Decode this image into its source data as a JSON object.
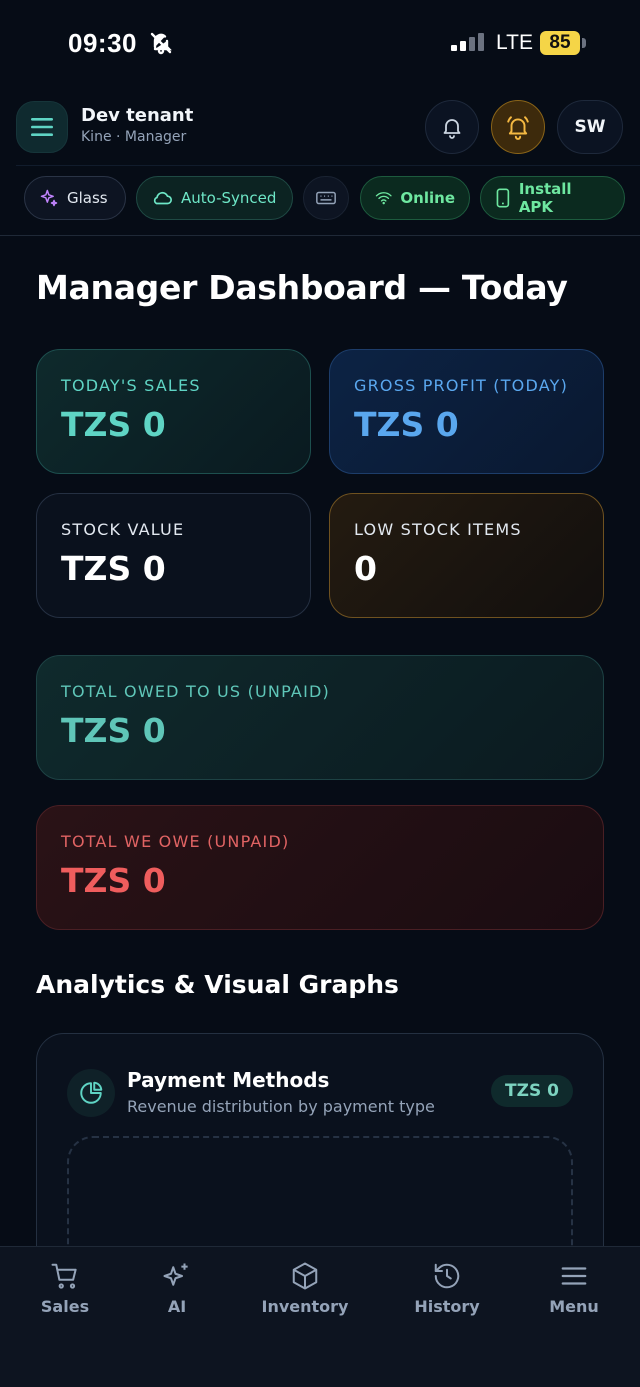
{
  "status_bar": {
    "time": "09:30",
    "network": "LTE",
    "battery": "85"
  },
  "header": {
    "tenant_name": "Dev tenant",
    "tenant_subtitle": "Kine · Manager",
    "avatar_initials": "SW"
  },
  "chips": {
    "glass": "Glass",
    "sync": "Auto-Synced",
    "online": "Online",
    "install": "Install APK"
  },
  "page_title": "Manager Dashboard — Today",
  "cards": {
    "sales": {
      "label": "TODAY'S SALES",
      "value": "TZS 0"
    },
    "profit": {
      "label": "GROSS PROFIT (TODAY)",
      "value": "TZS 0"
    },
    "stock": {
      "label": "STOCK VALUE",
      "value": "TZS 0"
    },
    "low_stock": {
      "label": "LOW STOCK ITEMS",
      "value": "0"
    },
    "owed_to_us": {
      "label": "TOTAL OWED TO US (UNPAID)",
      "value": "TZS 0"
    },
    "we_owe": {
      "label": "TOTAL WE OWE (UNPAID)",
      "value": "TZS 0"
    }
  },
  "analytics": {
    "section_title": "Analytics & Visual Graphs",
    "payment_methods": {
      "title": "Payment Methods",
      "subtitle": "Revenue distribution by payment type",
      "badge": "TZS 0"
    }
  },
  "bottom_nav": {
    "sales": "Sales",
    "ai": "AI",
    "inventory": "Inventory",
    "history": "History",
    "menu": "Menu"
  },
  "colors": {
    "background": "#060c16",
    "teal": "#5fd4c4",
    "blue": "#5aa7ee",
    "amber": "#f5b942",
    "red": "#ef5d5d",
    "green": "#6ee7a0"
  }
}
